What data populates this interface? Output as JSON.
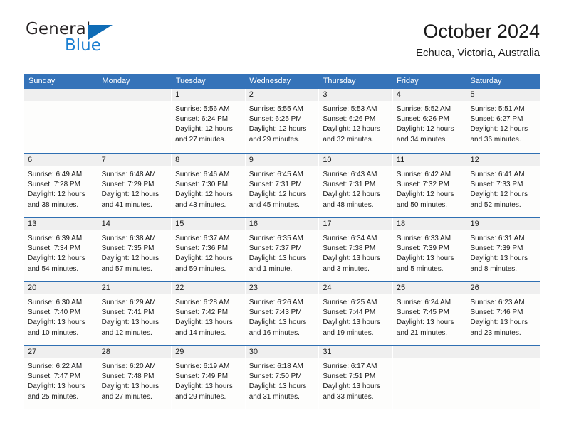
{
  "brand": {
    "name_top": "General",
    "name_bottom": "Blue",
    "triangle_color": "#0f6cb6",
    "blue_color": "#1b7fd1"
  },
  "header": {
    "title": "October 2024",
    "subtitle": "Echuca, Victoria, Australia"
  },
  "theme": {
    "header_bar": "#3573b9",
    "week_divider": "#2f6fb2",
    "date_band": "#efefef",
    "cell_bg": "#fdfdfc",
    "text": "#1a1a1a"
  },
  "weekdays": [
    "Sunday",
    "Monday",
    "Tuesday",
    "Wednesday",
    "Thursday",
    "Friday",
    "Saturday"
  ],
  "weeks": [
    [
      {
        "day": "",
        "sunrise": "",
        "sunset": "",
        "daylight1": "",
        "daylight2": ""
      },
      {
        "day": "",
        "sunrise": "",
        "sunset": "",
        "daylight1": "",
        "daylight2": ""
      },
      {
        "day": "1",
        "sunrise": "Sunrise: 5:56 AM",
        "sunset": "Sunset: 6:24 PM",
        "daylight1": "Daylight: 12 hours",
        "daylight2": "and 27 minutes."
      },
      {
        "day": "2",
        "sunrise": "Sunrise: 5:55 AM",
        "sunset": "Sunset: 6:25 PM",
        "daylight1": "Daylight: 12 hours",
        "daylight2": "and 29 minutes."
      },
      {
        "day": "3",
        "sunrise": "Sunrise: 5:53 AM",
        "sunset": "Sunset: 6:26 PM",
        "daylight1": "Daylight: 12 hours",
        "daylight2": "and 32 minutes."
      },
      {
        "day": "4",
        "sunrise": "Sunrise: 5:52 AM",
        "sunset": "Sunset: 6:26 PM",
        "daylight1": "Daylight: 12 hours",
        "daylight2": "and 34 minutes."
      },
      {
        "day": "5",
        "sunrise": "Sunrise: 5:51 AM",
        "sunset": "Sunset: 6:27 PM",
        "daylight1": "Daylight: 12 hours",
        "daylight2": "and 36 minutes."
      }
    ],
    [
      {
        "day": "6",
        "sunrise": "Sunrise: 6:49 AM",
        "sunset": "Sunset: 7:28 PM",
        "daylight1": "Daylight: 12 hours",
        "daylight2": "and 38 minutes."
      },
      {
        "day": "7",
        "sunrise": "Sunrise: 6:48 AM",
        "sunset": "Sunset: 7:29 PM",
        "daylight1": "Daylight: 12 hours",
        "daylight2": "and 41 minutes."
      },
      {
        "day": "8",
        "sunrise": "Sunrise: 6:46 AM",
        "sunset": "Sunset: 7:30 PM",
        "daylight1": "Daylight: 12 hours",
        "daylight2": "and 43 minutes."
      },
      {
        "day": "9",
        "sunrise": "Sunrise: 6:45 AM",
        "sunset": "Sunset: 7:31 PM",
        "daylight1": "Daylight: 12 hours",
        "daylight2": "and 45 minutes."
      },
      {
        "day": "10",
        "sunrise": "Sunrise: 6:43 AM",
        "sunset": "Sunset: 7:31 PM",
        "daylight1": "Daylight: 12 hours",
        "daylight2": "and 48 minutes."
      },
      {
        "day": "11",
        "sunrise": "Sunrise: 6:42 AM",
        "sunset": "Sunset: 7:32 PM",
        "daylight1": "Daylight: 12 hours",
        "daylight2": "and 50 minutes."
      },
      {
        "day": "12",
        "sunrise": "Sunrise: 6:41 AM",
        "sunset": "Sunset: 7:33 PM",
        "daylight1": "Daylight: 12 hours",
        "daylight2": "and 52 minutes."
      }
    ],
    [
      {
        "day": "13",
        "sunrise": "Sunrise: 6:39 AM",
        "sunset": "Sunset: 7:34 PM",
        "daylight1": "Daylight: 12 hours",
        "daylight2": "and 54 minutes."
      },
      {
        "day": "14",
        "sunrise": "Sunrise: 6:38 AM",
        "sunset": "Sunset: 7:35 PM",
        "daylight1": "Daylight: 12 hours",
        "daylight2": "and 57 minutes."
      },
      {
        "day": "15",
        "sunrise": "Sunrise: 6:37 AM",
        "sunset": "Sunset: 7:36 PM",
        "daylight1": "Daylight: 12 hours",
        "daylight2": "and 59 minutes."
      },
      {
        "day": "16",
        "sunrise": "Sunrise: 6:35 AM",
        "sunset": "Sunset: 7:37 PM",
        "daylight1": "Daylight: 13 hours",
        "daylight2": "and 1 minute."
      },
      {
        "day": "17",
        "sunrise": "Sunrise: 6:34 AM",
        "sunset": "Sunset: 7:38 PM",
        "daylight1": "Daylight: 13 hours",
        "daylight2": "and 3 minutes."
      },
      {
        "day": "18",
        "sunrise": "Sunrise: 6:33 AM",
        "sunset": "Sunset: 7:39 PM",
        "daylight1": "Daylight: 13 hours",
        "daylight2": "and 5 minutes."
      },
      {
        "day": "19",
        "sunrise": "Sunrise: 6:31 AM",
        "sunset": "Sunset: 7:39 PM",
        "daylight1": "Daylight: 13 hours",
        "daylight2": "and 8 minutes."
      }
    ],
    [
      {
        "day": "20",
        "sunrise": "Sunrise: 6:30 AM",
        "sunset": "Sunset: 7:40 PM",
        "daylight1": "Daylight: 13 hours",
        "daylight2": "and 10 minutes."
      },
      {
        "day": "21",
        "sunrise": "Sunrise: 6:29 AM",
        "sunset": "Sunset: 7:41 PM",
        "daylight1": "Daylight: 13 hours",
        "daylight2": "and 12 minutes."
      },
      {
        "day": "22",
        "sunrise": "Sunrise: 6:28 AM",
        "sunset": "Sunset: 7:42 PM",
        "daylight1": "Daylight: 13 hours",
        "daylight2": "and 14 minutes."
      },
      {
        "day": "23",
        "sunrise": "Sunrise: 6:26 AM",
        "sunset": "Sunset: 7:43 PM",
        "daylight1": "Daylight: 13 hours",
        "daylight2": "and 16 minutes."
      },
      {
        "day": "24",
        "sunrise": "Sunrise: 6:25 AM",
        "sunset": "Sunset: 7:44 PM",
        "daylight1": "Daylight: 13 hours",
        "daylight2": "and 19 minutes."
      },
      {
        "day": "25",
        "sunrise": "Sunrise: 6:24 AM",
        "sunset": "Sunset: 7:45 PM",
        "daylight1": "Daylight: 13 hours",
        "daylight2": "and 21 minutes."
      },
      {
        "day": "26",
        "sunrise": "Sunrise: 6:23 AM",
        "sunset": "Sunset: 7:46 PM",
        "daylight1": "Daylight: 13 hours",
        "daylight2": "and 23 minutes."
      }
    ],
    [
      {
        "day": "27",
        "sunrise": "Sunrise: 6:22 AM",
        "sunset": "Sunset: 7:47 PM",
        "daylight1": "Daylight: 13 hours",
        "daylight2": "and 25 minutes."
      },
      {
        "day": "28",
        "sunrise": "Sunrise: 6:20 AM",
        "sunset": "Sunset: 7:48 PM",
        "daylight1": "Daylight: 13 hours",
        "daylight2": "and 27 minutes."
      },
      {
        "day": "29",
        "sunrise": "Sunrise: 6:19 AM",
        "sunset": "Sunset: 7:49 PM",
        "daylight1": "Daylight: 13 hours",
        "daylight2": "and 29 minutes."
      },
      {
        "day": "30",
        "sunrise": "Sunrise: 6:18 AM",
        "sunset": "Sunset: 7:50 PM",
        "daylight1": "Daylight: 13 hours",
        "daylight2": "and 31 minutes."
      },
      {
        "day": "31",
        "sunrise": "Sunrise: 6:17 AM",
        "sunset": "Sunset: 7:51 PM",
        "daylight1": "Daylight: 13 hours",
        "daylight2": "and 33 minutes."
      },
      {
        "day": "",
        "sunrise": "",
        "sunset": "",
        "daylight1": "",
        "daylight2": ""
      },
      {
        "day": "",
        "sunrise": "",
        "sunset": "",
        "daylight1": "",
        "daylight2": ""
      }
    ]
  ]
}
